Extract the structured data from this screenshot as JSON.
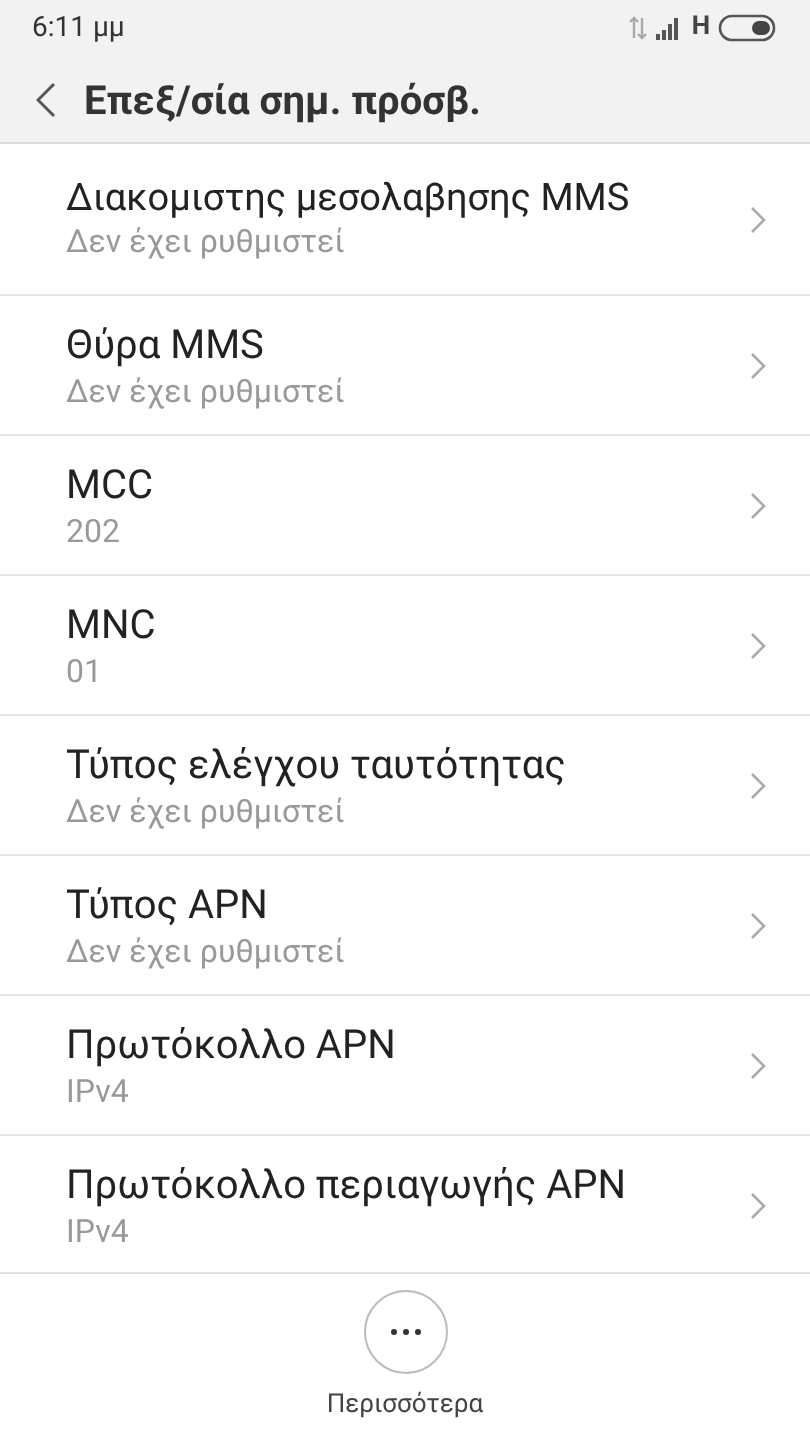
{
  "status_bar": {
    "time": "6:11 μμ",
    "network": "H"
  },
  "header": {
    "title": "Επεξ/σία σημ. πρόσβ."
  },
  "items": [
    {
      "title": "Διακομιστης μεσολαβησης MMS",
      "value": "Δεν έχει ρυθμιστεί"
    },
    {
      "title": "Θύρα MMS",
      "value": "Δεν έχει ρυθμιστεί"
    },
    {
      "title": "MCC",
      "value": "202"
    },
    {
      "title": "MNC",
      "value": "01"
    },
    {
      "title": "Τύπος ελέγχου ταυτότητας",
      "value": "Δεν έχει ρυθμιστεί"
    },
    {
      "title": "Τύπος APN",
      "value": "Δεν έχει ρυθμιστεί"
    },
    {
      "title": "Πρωτόκολλο APN",
      "value": "IPv4"
    },
    {
      "title": "Πρωτόκολλο περιαγωγής APN",
      "value": "IPv4"
    }
  ],
  "bottom_bar": {
    "more_label": "Περισσότερα"
  }
}
